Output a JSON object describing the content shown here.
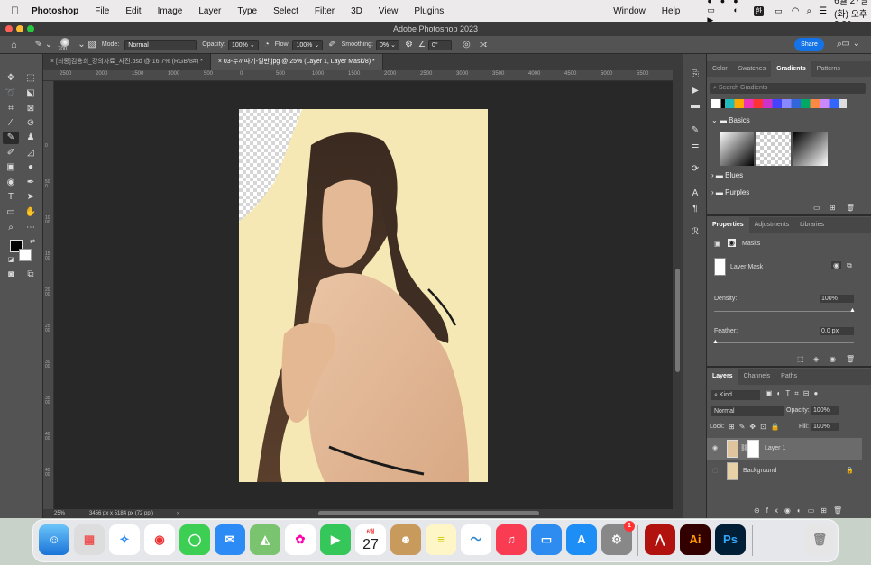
{
  "menubar": {
    "app": "Photoshop",
    "items": [
      "File",
      "Edit",
      "Image",
      "Layer",
      "Type",
      "Select",
      "Filter",
      "3D",
      "View",
      "Plugins"
    ],
    "right_items": [
      "Window",
      "Help"
    ],
    "datetime": "6월 27일 (화) 오후 9:30",
    "input_lang": "한"
  },
  "window": {
    "title": "Adobe Photoshop 2023"
  },
  "options": {
    "brush_size": "700",
    "mode_label": "Mode:",
    "mode_value": "Normal",
    "opacity_label": "Opacity:",
    "opacity_value": "100%",
    "flow_label": "Flow:",
    "flow_value": "100%",
    "smoothing_label": "Smoothing:",
    "smoothing_value": "0%",
    "angle_value": "0°",
    "share_label": "Share"
  },
  "tabs": [
    {
      "label": "[최종]김용희_강의자료_사진.psd @ 16.7% (RGB/8#) *"
    },
    {
      "label": "03-누끼따기-일반.jpg @ 25% (Layer 1, Layer Mask/8) *"
    }
  ],
  "ruler": {
    "h_ticks": [
      "2500",
      "2000",
      "1500",
      "1000",
      "500",
      "0",
      "500",
      "1000",
      "1500",
      "2000",
      "2500",
      "3000",
      "3500",
      "4000",
      "4500",
      "5000",
      "5500"
    ],
    "v_ticks": [
      "0",
      "500",
      "1000",
      "1500",
      "2000",
      "2500",
      "3000",
      "3500",
      "4000",
      "4500"
    ]
  },
  "status": {
    "zoom": "25%",
    "doc_size": "3456 px x 5184 px (72 ppi)"
  },
  "gradients_panel": {
    "tabs": [
      "Color",
      "Swatches",
      "Gradients",
      "Patterns"
    ],
    "search_placeholder": "Search Gradients",
    "groups": [
      "Basics",
      "Blues",
      "Purples"
    ]
  },
  "properties_panel": {
    "tabs": [
      "Properties",
      "Adjustments",
      "Libraries"
    ],
    "masks_label": "Masks",
    "layer_mask_label": "Layer Mask",
    "density_label": "Density:",
    "density_value": "100%",
    "feather_label": "Feather:",
    "feather_value": "0.0 px"
  },
  "layers_panel": {
    "tabs": [
      "Layers",
      "Channels",
      "Paths"
    ],
    "kind_label": "Kind",
    "blend_mode": "Normal",
    "opacity_label": "Opacity:",
    "opacity_value": "100%",
    "lock_label": "Lock:",
    "fill_label": "Fill:",
    "fill_value": "100%",
    "layers": [
      {
        "name": "Layer 1"
      },
      {
        "name": "Background"
      }
    ]
  },
  "dock": {
    "calendar_month": "6월",
    "calendar_day": "27",
    "badge": "1",
    "apps": [
      "Finder",
      "Launchpad",
      "Safari",
      "Chrome",
      "Messages",
      "Mail",
      "Maps",
      "Photos",
      "FaceTime",
      "Calendar",
      "Contacts",
      "Notes",
      "Freeform",
      "Music",
      "Keynote",
      "App Store",
      "System Settings",
      "Acrobat",
      "Illustrator",
      "Photoshop",
      "Trash"
    ]
  },
  "colors": {
    "accent": "#1473e6",
    "panel_bg": "#535353",
    "canvas_bg": "#282828",
    "photo_bg": "#f6e8b4"
  }
}
